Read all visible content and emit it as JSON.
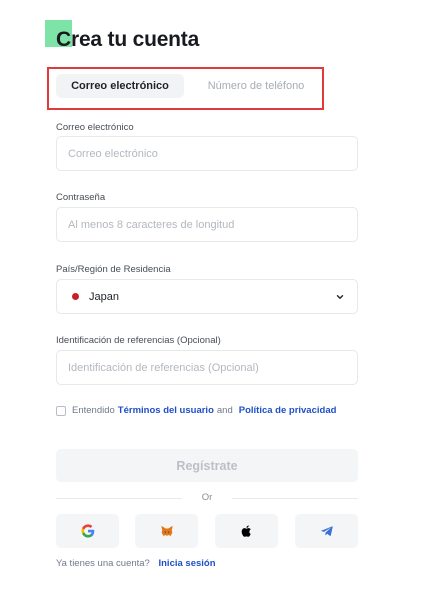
{
  "page": {
    "title": "Crea tu cuenta"
  },
  "tabs": [
    {
      "label": "Correo electrónico",
      "active": true
    },
    {
      "label": "Número de teléfono",
      "active": false
    }
  ],
  "form": {
    "email": {
      "label": "Correo electrónico",
      "placeholder": "Correo electrónico",
      "value": ""
    },
    "password": {
      "label": "Contraseña",
      "placeholder": "Al menos 8 caracteres de longitud",
      "value": ""
    },
    "country": {
      "label": "País/Región de Residencia",
      "value": "Japan"
    },
    "referral": {
      "label": "Identificación de referencias (Opcional)",
      "placeholder": "Identificación de referencias (Opcional)",
      "value": ""
    }
  },
  "terms": {
    "prefix": "Entendido",
    "terms_link": "Términos del usuario",
    "conjunction": "and",
    "privacy_link": "Política de privacidad",
    "checked": false
  },
  "register_button": "Regístrate",
  "divider_text": "Or",
  "social": [
    "google-icon",
    "metamask-icon",
    "apple-icon",
    "telegram-icon"
  ],
  "footer": {
    "text": "Ya tienes una cuenta?",
    "link": "Inicia sesión"
  },
  "colors": {
    "accent": "#7ee3a7",
    "highlight_outline": "#e03a3a",
    "link": "#1f4fc7",
    "flag": "#c8202a"
  }
}
